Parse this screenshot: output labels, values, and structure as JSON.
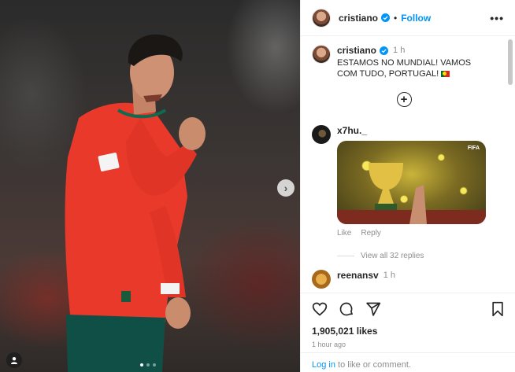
{
  "post": {
    "username": "cristiano",
    "follow_label": "Follow",
    "separator": "•",
    "more_label": "•••",
    "next_glyph": "›"
  },
  "caption": {
    "username": "cristiano",
    "time": "1 h",
    "text": "ESTAMOS NO MUNDIAL! VAMOS COM TUDO, PORTUGAL!"
  },
  "comments": [
    {
      "username": "x7hu._",
      "gif_label": "FIFA",
      "like_label": "Like",
      "reply_label": "Reply",
      "view_all_label": "View all 32 replies"
    },
    {
      "username": "reenansv",
      "time": "1 h"
    }
  ],
  "footer": {
    "likes": "1,905,021 likes",
    "time_ago": "1 hour ago",
    "login_link": "Log in",
    "login_text": " to like or comment."
  },
  "colors": {
    "link_blue": "#0095f6",
    "jersey_red": "#e8392b",
    "shorts_green": "#0f4f45"
  },
  "icons": [
    "verified-badge-icon",
    "more-options-icon",
    "chevron-right-icon",
    "user-tag-icon",
    "add-circle-icon",
    "heart-icon",
    "comment-icon",
    "share-icon",
    "bookmark-icon",
    "portugal-flag-icon"
  ]
}
